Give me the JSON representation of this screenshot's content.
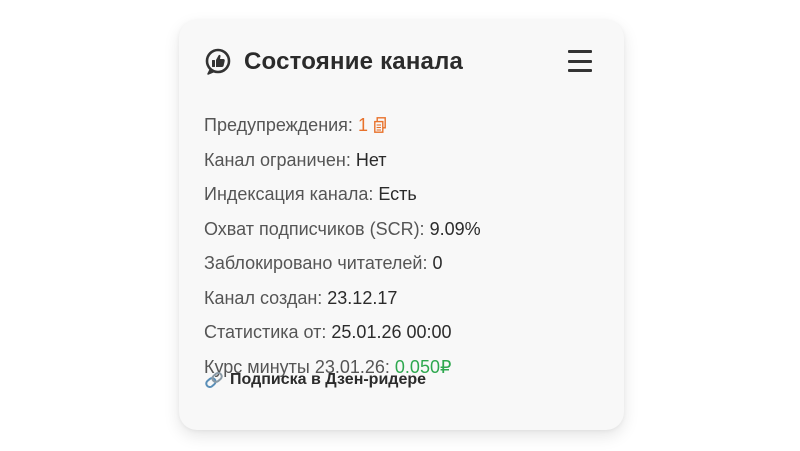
{
  "card": {
    "title": "Состояние канала",
    "header_icon": "thumbs-up-bubble-icon",
    "menu_icon": "hamburger-menu-icon"
  },
  "rows": [
    {
      "label": "Предупреждения: ",
      "value": "1"
    },
    {
      "label": "Канал ограничен: ",
      "value": "Нет"
    },
    {
      "label": "Индексация канала: ",
      "value": "Есть"
    },
    {
      "label": "Охват подписчиков (SCR): ",
      "value": "9.09%"
    },
    {
      "label": "Заблокировано читателей: ",
      "value": "0"
    },
    {
      "label": "Канал создан: ",
      "value": "23.12.17"
    },
    {
      "label": "Статистика от: ",
      "value": "25.01.26 00:00"
    },
    {
      "label": "Курс минуты 23.01.26: ",
      "value": "0.050₽"
    }
  ],
  "link": {
    "icon": "link-icon",
    "label": "Подписка в Дзен-ридере"
  },
  "colors": {
    "warning": "#e8722c",
    "positive": "#2ea84f",
    "text": "#2b2b2b",
    "label": "#555555",
    "card_bg": "#f8f8f8"
  }
}
